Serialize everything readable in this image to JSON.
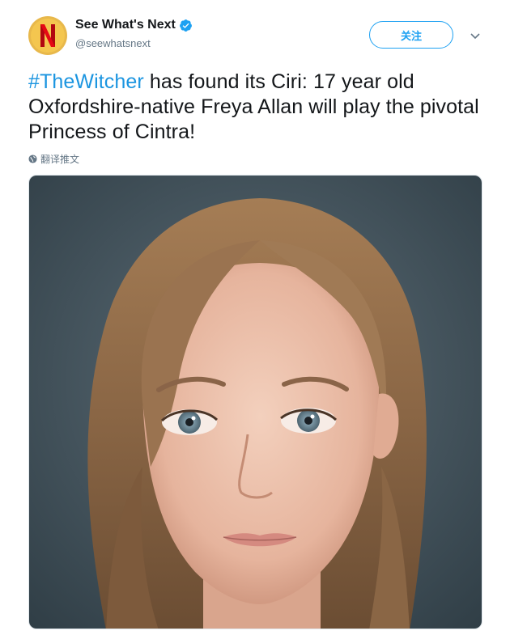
{
  "account": {
    "display_name": "See What's Next",
    "handle": "@seewhatsnext",
    "avatar_letter": "N",
    "avatar_colors": {
      "outer": "#e8b84b",
      "inner": "#f4c64f",
      "letter": "#e50914"
    },
    "verified": true
  },
  "follow_button": {
    "label": "关注"
  },
  "tweet": {
    "hashtag": "#TheWitcher",
    "text": " has found its Ciri: 17 year old Oxfordshire-native Freya Allan will play the pivotal Princess of Cintra!",
    "translate_label": "翻译推文"
  },
  "colors": {
    "accent": "#1da1f2",
    "hashtag": "#1b95e0",
    "text": "#14171a",
    "secondary_text": "#657786"
  },
  "icons": {
    "verified": "verified-badge-icon",
    "caret": "chevron-down-icon",
    "translate": "globe-icon"
  }
}
